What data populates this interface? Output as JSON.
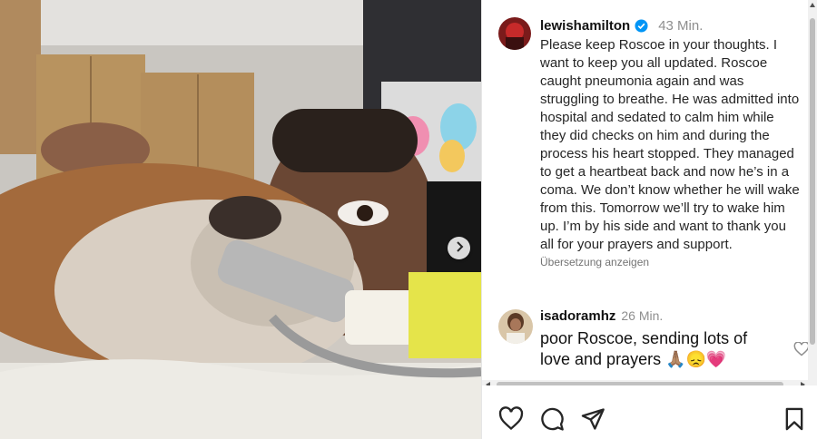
{
  "post": {
    "username": "lewishamilton",
    "time": "43 Min.",
    "caption": "Please keep Roscoe in your thoughts. I want to keep you all updated. Roscoe caught pneumonia again and was struggling to breathe. He was admitted into hospital and sedated to calm him while they did checks on him and during the process his heart stopped. They managed to get a heartbeat back and now he’s in a coma. We don’t know whether he will wake from this. Tomorrow we’ll try to wake him up. I’m by his side and want to thank you all for your prayers and support.",
    "translate_label": "Übersetzung anzeigen",
    "verified_color": "#0095f6"
  },
  "comment": {
    "username": "isadoramhz",
    "time": "26 Min.",
    "text": "poor Roscoe, sending lots of love and prayers 🙏🏽😞💗"
  },
  "actions": {
    "icons": [
      "heart-icon",
      "comment-icon",
      "share-icon",
      "bookmark-icon"
    ]
  },
  "media": {
    "carousel_icon": "chevron-right-icon"
  }
}
